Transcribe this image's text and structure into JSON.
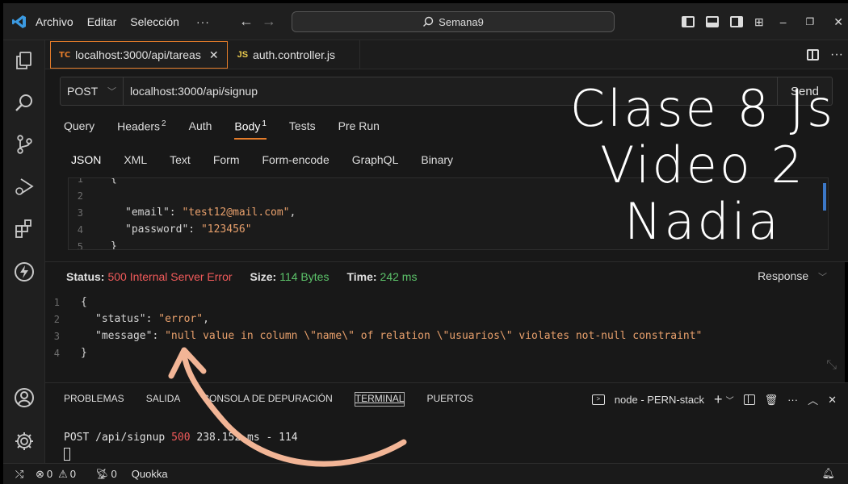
{
  "titlebar": {
    "menu": [
      "Archivo",
      "Editar",
      "Selección"
    ],
    "more": "···",
    "search": "Semana9"
  },
  "tabs": [
    {
      "badge": "TC",
      "label": "localhost:3000/api/tareas"
    },
    {
      "badge": "JS",
      "label": "auth.controller.js"
    }
  ],
  "request": {
    "method": "POST",
    "url": "localhost:3000/api/signup",
    "send": "Send",
    "tabs": [
      "Query",
      "Headers",
      "Auth",
      "Body",
      "Tests",
      "Pre Run"
    ],
    "headers_count": "2",
    "body_count": "1",
    "body_tabs": [
      "JSON",
      "XML",
      "Text",
      "Form",
      "Form-encode",
      "GraphQL",
      "Binary"
    ],
    "code_lines": [
      {
        "n": "1",
        "text": "{"
      },
      {
        "n": "2",
        "text": ""
      },
      {
        "n": "3",
        "key": "\"email\"",
        "val": "\"test12@mail.com\""
      },
      {
        "n": "4",
        "key": "\"password\"",
        "val": "\"123456\""
      },
      {
        "n": "5",
        "text": "}"
      }
    ]
  },
  "response": {
    "status_label": "Status:",
    "status_value": "500 Internal Server Error",
    "size_label": "Size:",
    "size_value": "114 Bytes",
    "time_label": "Time:",
    "time_value": "242 ms",
    "view": "Response",
    "lines": [
      {
        "n": "1",
        "text": "{"
      },
      {
        "n": "2",
        "key": "\"status\"",
        "val": "\"error\""
      },
      {
        "n": "3",
        "key": "\"message\"",
        "val": "\"null value in column \\\"name\\\" of relation \\\"usuarios\\\" violates not-null constraint\""
      },
      {
        "n": "4",
        "text": "}"
      }
    ]
  },
  "panel": {
    "tabs": [
      "PROBLEMAS",
      "SALIDA",
      "CONSOLA DE DEPURACIÓN",
      "TERMINAL",
      "PUERTOS"
    ],
    "active_tab": "TERMINAL",
    "terminal_name": "node - PERN-stack",
    "log_method_path": "POST /api/signup ",
    "log_status": "500",
    "log_rest": " 238.152 ms - 114"
  },
  "statusbar": {
    "errors": "0",
    "warnings": "0",
    "ports": "0",
    "extension": "Quokka"
  },
  "overlay": {
    "line1": "Clase 8 Js",
    "line2": "Video 2",
    "line3": "Nadia"
  },
  "colors": {
    "accent": "#e57c2a",
    "error": "#f05a5a",
    "success": "#5cc36a",
    "string": "#e8a06c",
    "annotation_arrow": "#f2b596"
  }
}
